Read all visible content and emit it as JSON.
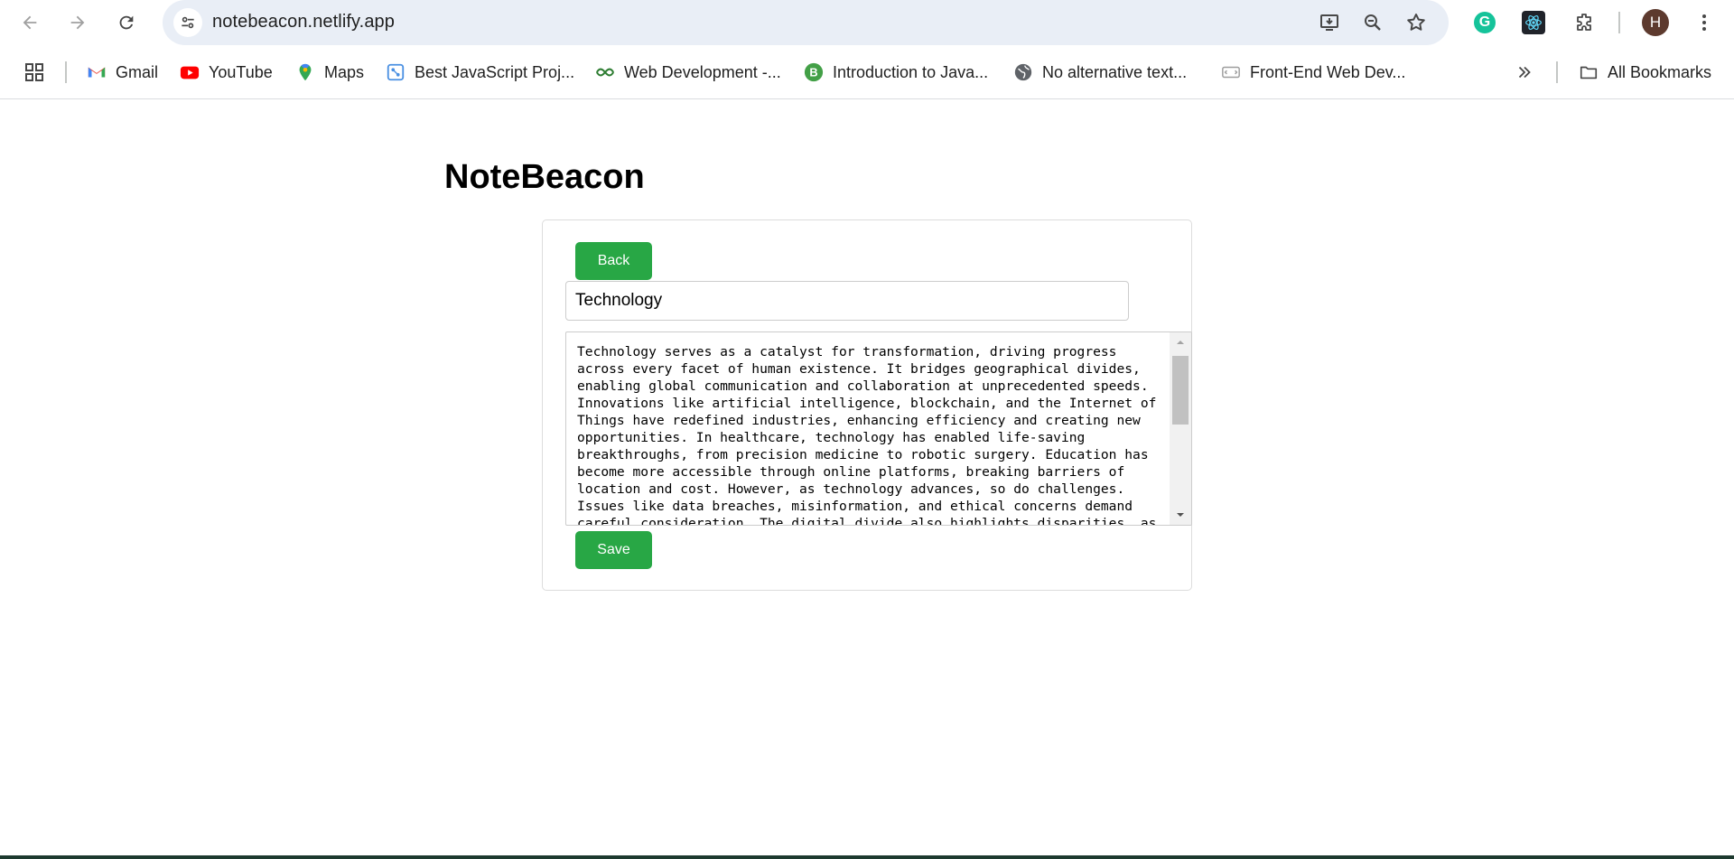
{
  "browser": {
    "url": "notebeacon.netlify.app",
    "profile_initial": "H",
    "bookmarks": [
      {
        "label": "Gmail",
        "icon": "gmail-icon"
      },
      {
        "label": "YouTube",
        "icon": "youtube-icon"
      },
      {
        "label": "Maps",
        "icon": "maps-icon"
      },
      {
        "label": "Best JavaScript Proj...",
        "icon": "js-projects-icon"
      },
      {
        "label": "Web Development -...",
        "icon": "web-dev-icon"
      },
      {
        "label": "Introduction to Java...",
        "icon": "java-intro-icon"
      },
      {
        "label": "No alternative text...",
        "icon": "globe-icon"
      },
      {
        "label": "Front-End Web Dev...",
        "icon": "frontend-icon"
      }
    ],
    "all_bookmarks_label": "All Bookmarks"
  },
  "app": {
    "title": "NoteBeacon",
    "back_label": "Back",
    "save_label": "Save",
    "note_title": "Technology",
    "note_body": "Technology serves as a catalyst for transformation, driving progress\nacross every facet of human existence. It bridges geographical divides,\nenabling global communication and collaboration at unprecedented speeds.\nInnovations like artificial intelligence, blockchain, and the Internet of\nThings have redefined industries, enhancing efficiency and creating new\nopportunities. In healthcare, technology has enabled life-saving\nbreakthroughs, from precision medicine to robotic surgery. Education has\nbecome more accessible through online platforms, breaking barriers of\nlocation and cost. However, as technology advances, so do challenges.\nIssues like data breaches, misinformation, and ethical concerns demand\ncareful consideration. The digital divide also highlights disparities, as"
  },
  "colors": {
    "button_green": "#28a745",
    "omnibox_bg": "#e9eef6"
  }
}
